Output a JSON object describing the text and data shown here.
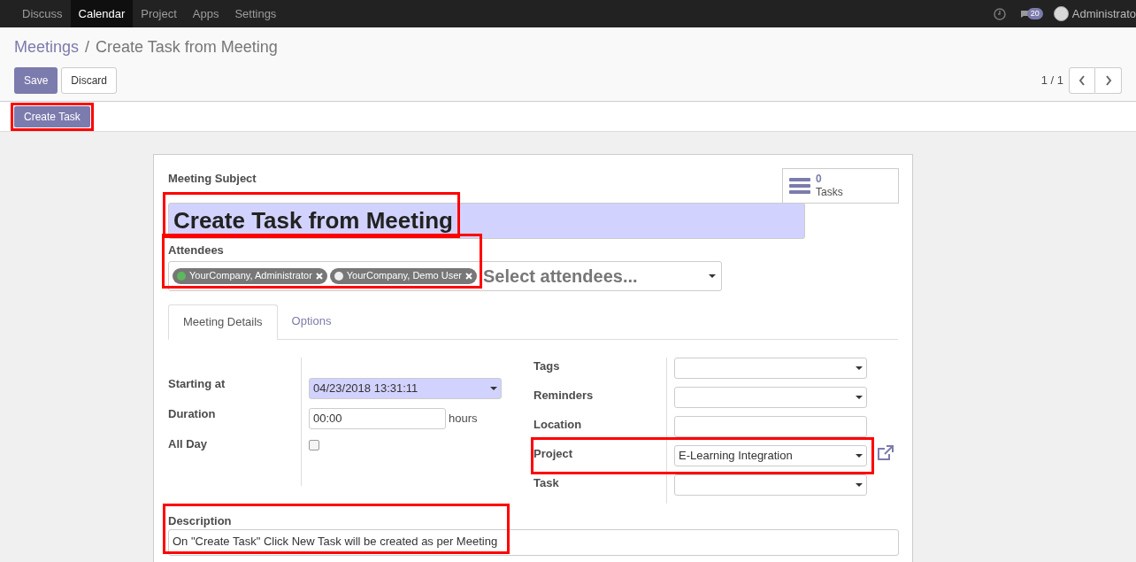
{
  "navbar": {
    "menu": [
      {
        "label": "Discuss",
        "selected": false
      },
      {
        "label": "Calendar",
        "selected": true
      },
      {
        "label": "Project",
        "selected": false
      },
      {
        "label": "Apps",
        "selected": false
      },
      {
        "label": "Settings",
        "selected": false
      }
    ],
    "message_count": "20",
    "user": "Administrato"
  },
  "breadcrumb": {
    "parent": "Meetings",
    "separator": "/",
    "current": "Create Task from Meeting"
  },
  "buttons": {
    "save": "Save",
    "discard": "Discard"
  },
  "pager": "1 / 1",
  "header_button": {
    "label": "Create Task",
    "highlighted": true
  },
  "form": {
    "subject_label": "Meeting Subject",
    "subject": "Create Task from Meeting",
    "subject_highlighted": true,
    "smart_button": {
      "count": "0",
      "label": "Tasks"
    },
    "attendees_label": "Attendees",
    "attendees_highlighted": true,
    "attendees": [
      {
        "name": "YourCompany, Administrator",
        "color": "#5cb85c"
      },
      {
        "name": "YourCompany, Demo User",
        "color": "#eeeeee"
      }
    ],
    "attendees_placeholder": "Select attendees...",
    "tabs": [
      {
        "label": "Meeting Details",
        "selected": true
      },
      {
        "label": "Options",
        "selected": false
      }
    ],
    "left_fields": [
      {
        "kind": "datetime",
        "label": "Starting at",
        "value": "04/23/2018 13:31:11"
      },
      {
        "kind": "duration",
        "label": "Duration",
        "value": "00:00",
        "unit": "hours"
      },
      {
        "kind": "checkbox",
        "label": "All Day",
        "checked": false
      }
    ],
    "right_fields": [
      {
        "kind": "select",
        "label": "Tags",
        "highlighted": false,
        "external": false
      },
      {
        "kind": "select",
        "label": "Reminders",
        "highlighted": false,
        "external": false
      },
      {
        "kind": "text",
        "label": "Location",
        "highlighted": false,
        "external": false
      },
      {
        "kind": "select",
        "label": "Project",
        "value": "E-Learning Integration",
        "highlighted": true,
        "external": true
      },
      {
        "kind": "select",
        "label": "Task",
        "highlighted": false,
        "external": false
      }
    ],
    "description_label": "Description",
    "description": "On \"Create Task\" Click New Task will be created as per Meeting",
    "description_highlighted": true
  }
}
